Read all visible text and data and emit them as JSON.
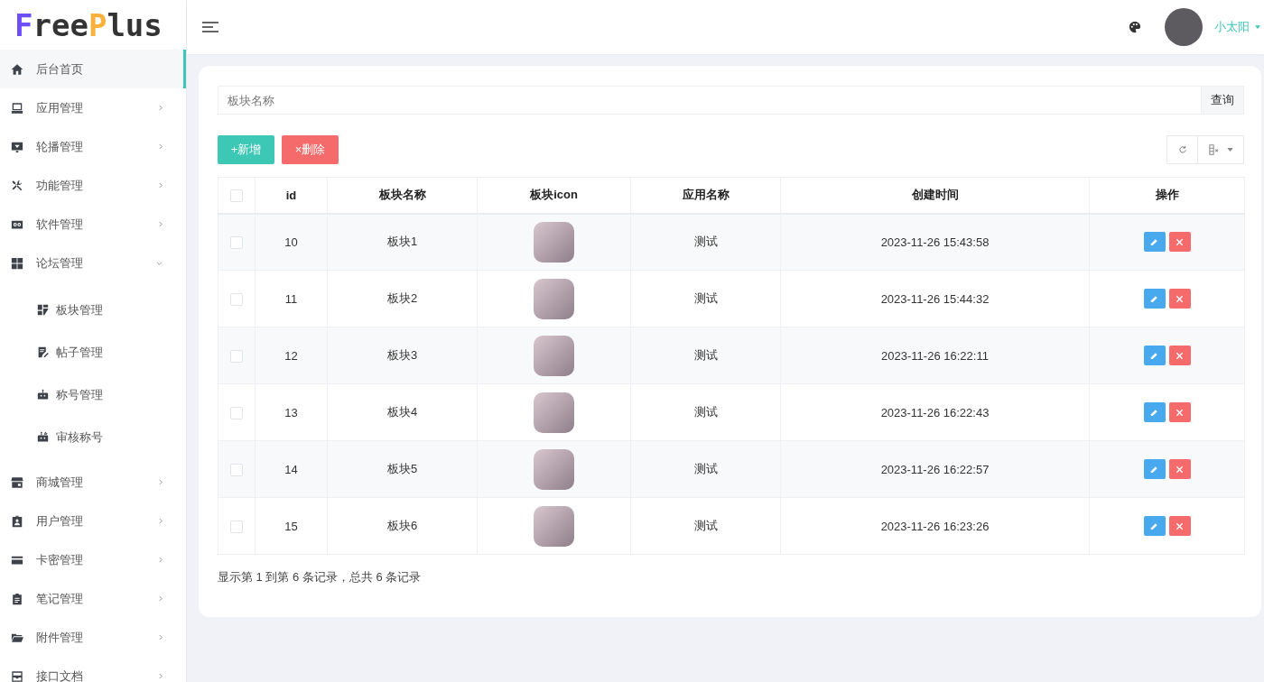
{
  "logo": {
    "segments": [
      {
        "text": "F",
        "color": "#6b4ef5"
      },
      {
        "text": "ree",
        "color": "#333333"
      },
      {
        "text": "P",
        "color": "#fbb13c"
      },
      {
        "text": "lus",
        "color": "#333333"
      }
    ]
  },
  "sidebar": {
    "items": [
      {
        "label": "后台首页",
        "kind": "page",
        "selected": true
      },
      {
        "label": "应用管理",
        "kind": "menu",
        "selected": false,
        "expanded": false
      },
      {
        "label": "轮播管理",
        "kind": "menu",
        "selected": false,
        "expanded": false
      },
      {
        "label": "功能管理",
        "kind": "menu",
        "selected": false,
        "expanded": false
      },
      {
        "label": "软件管理",
        "kind": "menu",
        "selected": false,
        "expanded": false
      },
      {
        "label": "论坛管理",
        "kind": "menu",
        "selected": false,
        "expanded": true,
        "children": [
          {
            "label": "板块管理",
            "selected": false
          },
          {
            "label": "帖子管理",
            "selected": false
          },
          {
            "label": "称号管理",
            "selected": false
          },
          {
            "label": "审核称号",
            "selected": false
          }
        ]
      },
      {
        "label": "商城管理",
        "kind": "menu",
        "selected": false,
        "expanded": false
      },
      {
        "label": "用户管理",
        "kind": "menu",
        "selected": false,
        "expanded": false
      },
      {
        "label": "卡密管理",
        "kind": "menu",
        "selected": false,
        "expanded": false
      },
      {
        "label": "笔记管理",
        "kind": "menu",
        "selected": false,
        "expanded": false
      },
      {
        "label": "附件管理",
        "kind": "menu",
        "selected": false,
        "expanded": false
      },
      {
        "label": "接口文档",
        "kind": "menu",
        "selected": false,
        "expanded": false
      }
    ]
  },
  "header": {
    "user": "小太阳"
  },
  "search": {
    "placeholder": "板块名称",
    "button": "查询"
  },
  "actions": [
    {
      "kind": "add",
      "label": "+新增"
    },
    {
      "kind": "delete",
      "label": "×删除"
    }
  ],
  "table": {
    "header_checked": false,
    "columns": [
      "id",
      "板块名称",
      "板块icon",
      "应用名称",
      "创建时间",
      "操作"
    ],
    "rows": [
      {
        "checked": false,
        "id": "10",
        "name": "板块1",
        "app": "测试",
        "created": "2023-11-26 15:43:58"
      },
      {
        "checked": false,
        "id": "11",
        "name": "板块2",
        "app": "测试",
        "created": "2023-11-26 15:44:32"
      },
      {
        "checked": false,
        "id": "12",
        "name": "板块3",
        "app": "测试",
        "created": "2023-11-26 16:22:11"
      },
      {
        "checked": false,
        "id": "13",
        "name": "板块4",
        "app": "测试",
        "created": "2023-11-26 16:22:43"
      },
      {
        "checked": false,
        "id": "14",
        "name": "板块5",
        "app": "测试",
        "created": "2023-11-26 16:22:57"
      },
      {
        "checked": false,
        "id": "15",
        "name": "板块6",
        "app": "测试",
        "created": "2023-11-26 16:23:26"
      }
    ]
  },
  "summary": "显示第 1 到第 6 条记录，总共 6 条记录"
}
